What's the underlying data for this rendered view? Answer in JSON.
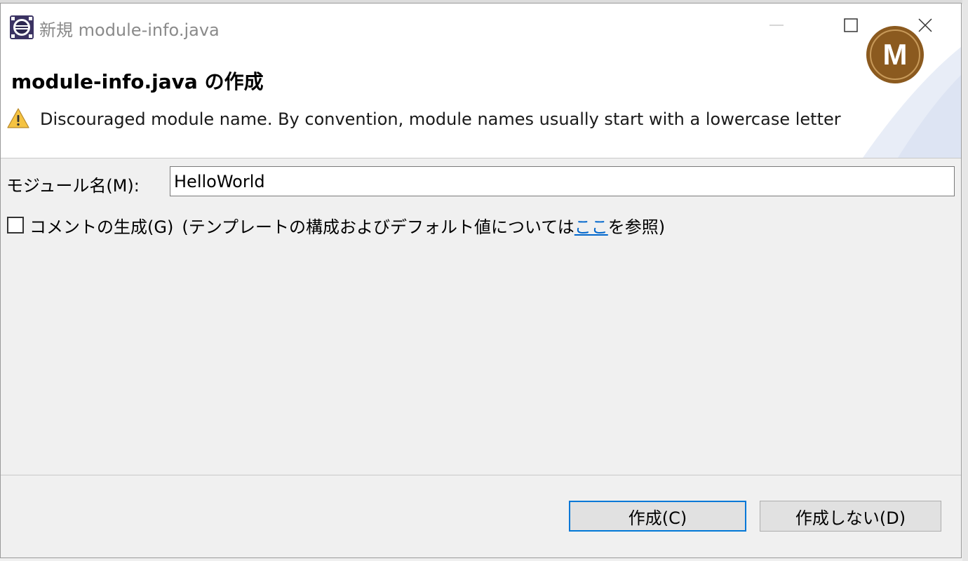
{
  "window": {
    "title": "新規 module-info.java",
    "buttons": [
      "minimize",
      "maximize",
      "close"
    ]
  },
  "header": {
    "title": "module-info.java の作成",
    "warning_message": "Discouraged module name. By convention, module names usually start with a lowercase letter",
    "logo_letter": "M"
  },
  "form": {
    "module_name_label": "モジュール名(M):",
    "module_name_value": "HelloWorld",
    "generate_comments_label": "コメントの生成(G)",
    "generate_comments_checked": false,
    "hint_prefix": "(テンプレートの構成およびデフォルト値については",
    "hint_link": "ここ",
    "hint_suffix": "を参照)"
  },
  "buttons": {
    "create": "作成(C)",
    "dont_create": "作成しない(D)"
  },
  "colors": {
    "accent": "#0078d7",
    "link": "#0066cc",
    "logo_brown": "#8b5a1f",
    "warning_yellow": "#f5c342"
  }
}
